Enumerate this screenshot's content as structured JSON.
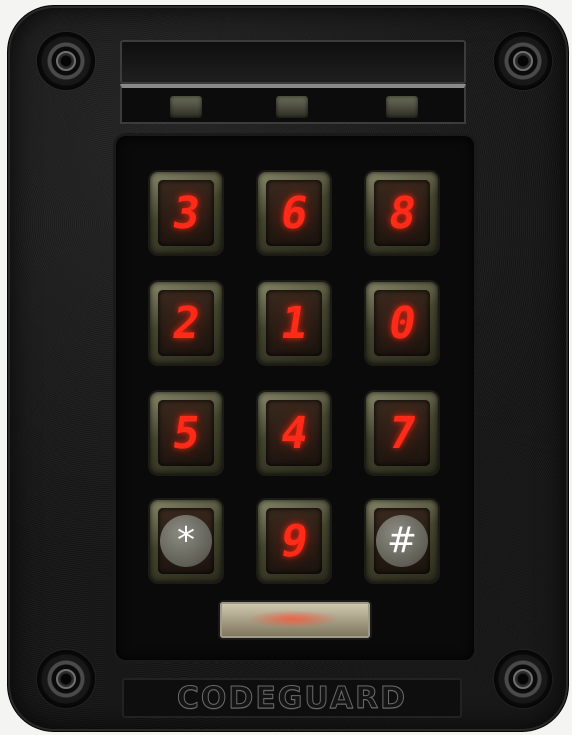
{
  "keypad": {
    "rows": [
      [
        "3",
        "6",
        "8"
      ],
      [
        "2",
        "1",
        "0"
      ],
      [
        "5",
        "4",
        "7"
      ]
    ],
    "bottom": {
      "left": "*",
      "center": "9",
      "right": "#"
    }
  },
  "brand": "CODEGUARD",
  "colors": {
    "digit": "#ff2a18",
    "housing": "#151515",
    "status_led": "#e04a35"
  }
}
